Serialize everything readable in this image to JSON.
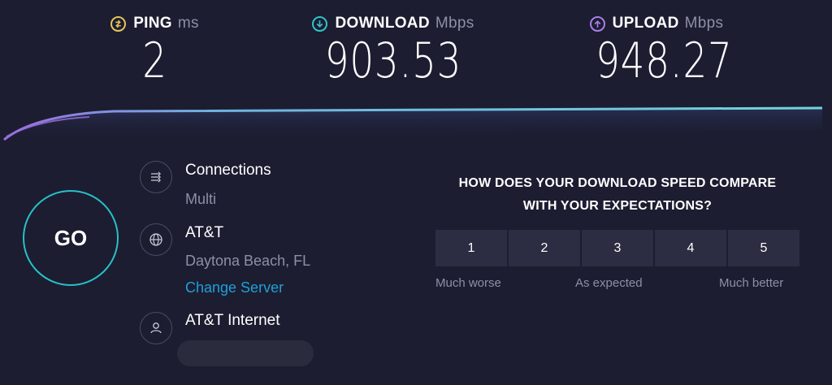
{
  "metrics": {
    "ping": {
      "label": "PING",
      "unit": "ms",
      "value": "2",
      "icon": "ping-icon",
      "color": "#e5c55a"
    },
    "download": {
      "label": "DOWNLOAD",
      "unit": "Mbps",
      "value": "903.53",
      "icon": "download-arrow-icon",
      "color": "#34c3c9"
    },
    "upload": {
      "label": "UPLOAD",
      "unit": "Mbps",
      "value": "948.27",
      "icon": "upload-arrow-icon",
      "color": "#a87ee8"
    }
  },
  "go": {
    "label": "GO"
  },
  "info": {
    "connections": {
      "title": "Connections",
      "value": "Multi",
      "icon": "connections-icon"
    },
    "server": {
      "title": "AT&T",
      "location": "Daytona Beach, FL",
      "change_label": "Change Server",
      "icon": "globe-icon"
    },
    "provider": {
      "title": "AT&T Internet",
      "icon": "user-icon"
    }
  },
  "survey": {
    "question_line1": "HOW DOES YOUR DOWNLOAD SPEED COMPARE",
    "question_line2": "WITH YOUR EXPECTATIONS?",
    "options": [
      "1",
      "2",
      "3",
      "4",
      "5"
    ],
    "labels": {
      "low": "Much worse",
      "mid": "As expected",
      "high": "Much better"
    }
  },
  "colors": {
    "background": "#1c1d31",
    "accent": "#28c0c8",
    "link": "#1ea0d8",
    "muted": "#8e8fa6"
  }
}
